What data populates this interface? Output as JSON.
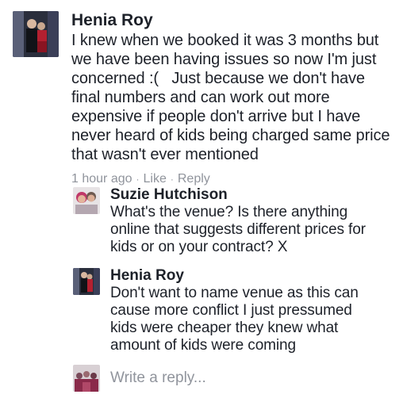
{
  "comment": {
    "author": "Henia Roy",
    "lines": [
      "I knew when we booked it was 3 months but",
      "we have been having issues so now I'm just",
      "concerned :(   Just because we don't have",
      "final numbers and can work out more",
      "expensive if people don't arrive but I have",
      "never heard of kids being charged same price",
      "that wasn't ever mentioned"
    ],
    "time": "1 hour ago",
    "separator": "·",
    "like_label": "Like",
    "reply_label": "Reply",
    "avatar_icon": "profile-photo-icon"
  },
  "replies": [
    {
      "author": "Suzie Hutchison",
      "lines": [
        "What's the venue? Is there anything",
        "online that suggests different prices for",
        "kids or on your contract? X"
      ],
      "avatar_icon": "profile-photo-icon"
    },
    {
      "author": "Henia Roy",
      "lines": [
        "Don't want to name venue as this can",
        "cause more conflict I just pressumed",
        "kids were cheaper they knew what",
        "amount of kids were coming"
      ],
      "avatar_icon": "profile-photo-icon"
    }
  ],
  "compose": {
    "placeholder": "Write a reply...",
    "avatar_icon": "profile-photo-icon"
  }
}
